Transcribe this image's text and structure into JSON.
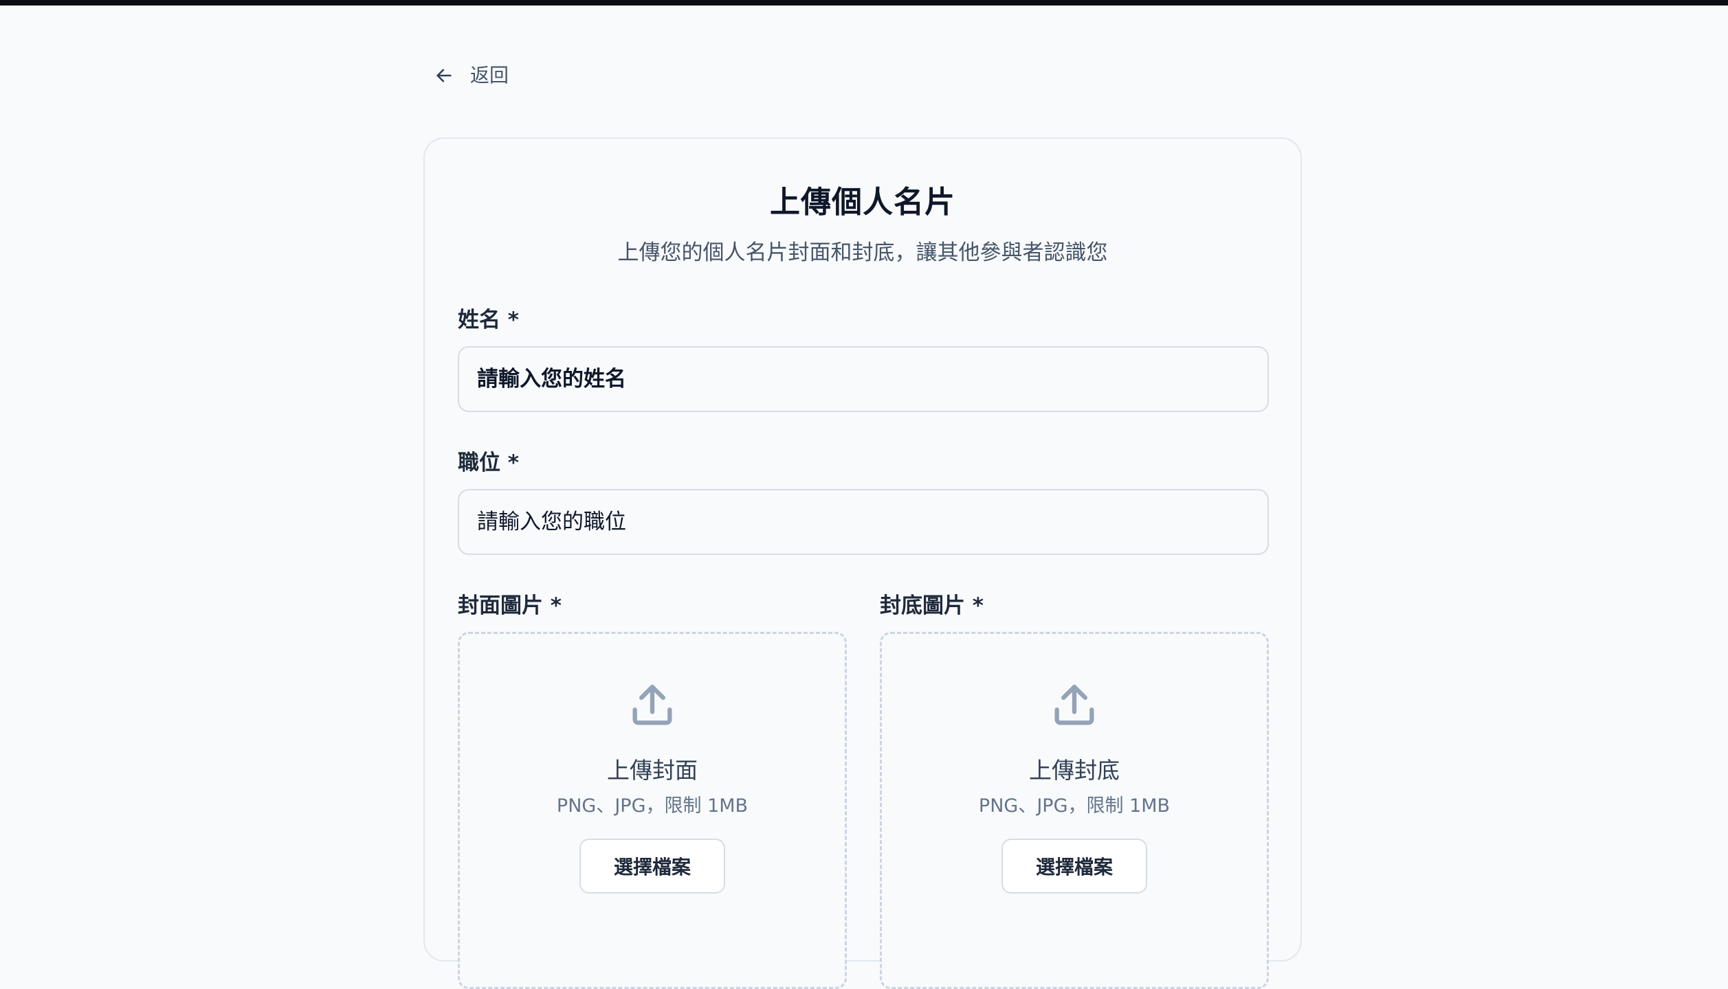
{
  "nav": {
    "back_label": "返回"
  },
  "card": {
    "title": "上傳個人名片",
    "subtitle": "上傳您的個人名片封面和封底，讓其他參與者認識您"
  },
  "form": {
    "name": {
      "label": "姓名 *",
      "placeholder": "請輸入您的姓名",
      "value": ""
    },
    "position": {
      "label": "職位 *",
      "placeholder": "請輸入您的職位",
      "value": ""
    },
    "front_image": {
      "label": "封面圖片 *",
      "title": "上傳封面",
      "hint": "PNG、JPG，限制 1MB",
      "button_label": "選擇檔案",
      "icon": "upload-icon"
    },
    "back_image": {
      "label": "封底圖片 *",
      "title": "上傳封底",
      "hint": "PNG、JPG，限制 1MB",
      "button_label": "選擇檔案",
      "icon": "upload-icon"
    }
  },
  "colors": {
    "background": "#f8fafc",
    "text_primary": "#0f172a",
    "text_secondary": "#475569",
    "border": "#d7dde5",
    "dashed_border": "#cbd5e1",
    "icon": "#94a3b8"
  }
}
